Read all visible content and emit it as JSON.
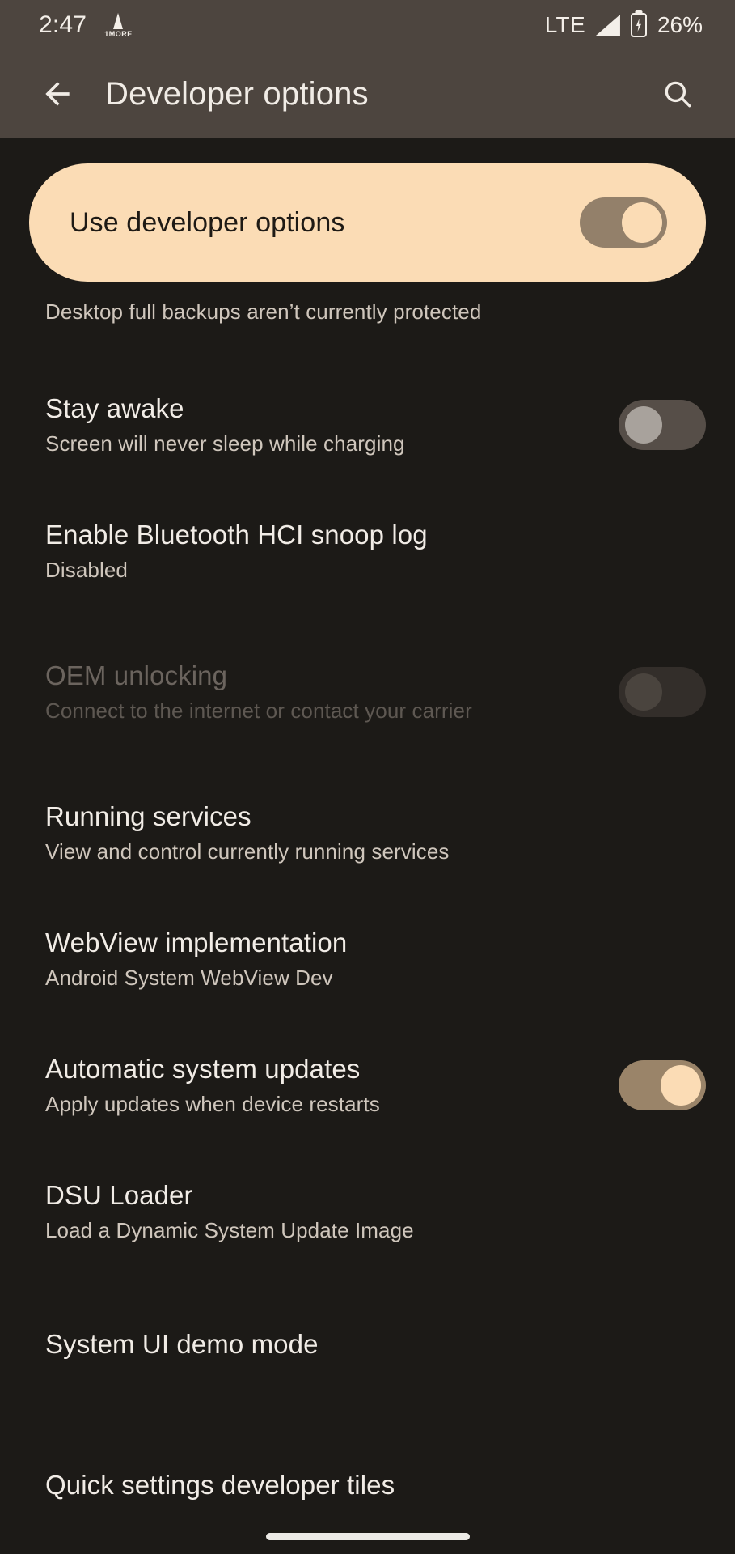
{
  "status_bar": {
    "clock": "2:47",
    "notification_icon_label": "1MORE",
    "network_type": "LTE",
    "signal_icon": "signal-bars-icon",
    "battery_icon": "battery-charging-icon",
    "battery_percent": "26%"
  },
  "app_bar": {
    "back_icon": "arrow-back-icon",
    "title": "Developer options",
    "search_icon": "search-icon"
  },
  "master_switch": {
    "label": "Use developer options",
    "state": "on",
    "track_color": "#93806a",
    "knob_color": "#fbdcb5",
    "card_color": "#fbdcb5",
    "card_text_color": "#1e1a15"
  },
  "theme": {
    "background": "#1c1a17",
    "bar_background": "#4d453f",
    "title_text": "#f1ece6",
    "subtitle_text": "#cfc6bc",
    "disabled_text": "#6b645e",
    "accent": "#fbdcb5"
  },
  "items": [
    {
      "name": "local-terminal-clipped",
      "title": "",
      "subtitle": "Desktop full backups aren’t currently protected",
      "control": "none",
      "enabled": true,
      "clipped": true
    },
    {
      "name": "stay-awake",
      "title": "Stay awake",
      "subtitle": "Screen will never sleep while charging",
      "control": "switch",
      "switch_state": "off",
      "enabled": true
    },
    {
      "name": "enable-bluetooth-hci-snoop-log",
      "title": "Enable Bluetooth HCI snoop log",
      "subtitle": "Disabled",
      "control": "none",
      "enabled": true
    },
    {
      "name": "oem-unlocking",
      "title": "OEM unlocking",
      "subtitle": "Connect to the internet or contact your carrier",
      "control": "switch",
      "switch_state": "disabled",
      "enabled": false
    },
    {
      "name": "running-services",
      "title": "Running services",
      "subtitle": "View and control currently running services",
      "control": "none",
      "enabled": true
    },
    {
      "name": "webview-implementation",
      "title": "WebView implementation",
      "subtitle": "Android System WebView Dev",
      "control": "none",
      "enabled": true
    },
    {
      "name": "automatic-system-updates",
      "title": "Automatic system updates",
      "subtitle": "Apply updates when device restarts",
      "control": "switch",
      "switch_state": "on",
      "enabled": true
    },
    {
      "name": "dsu-loader",
      "title": "DSU Loader",
      "subtitle": "Load a Dynamic System Update Image",
      "control": "none",
      "enabled": true
    },
    {
      "name": "system-ui-demo-mode",
      "title": "System UI demo mode",
      "subtitle": "",
      "control": "none",
      "enabled": true
    },
    {
      "name": "quick-settings-developer-tiles",
      "title": "Quick settings developer tiles",
      "subtitle": "",
      "control": "none",
      "enabled": true,
      "cut_off": true
    }
  ],
  "navigation_bar": {
    "gesture_pill": "home-gesture-pill"
  }
}
